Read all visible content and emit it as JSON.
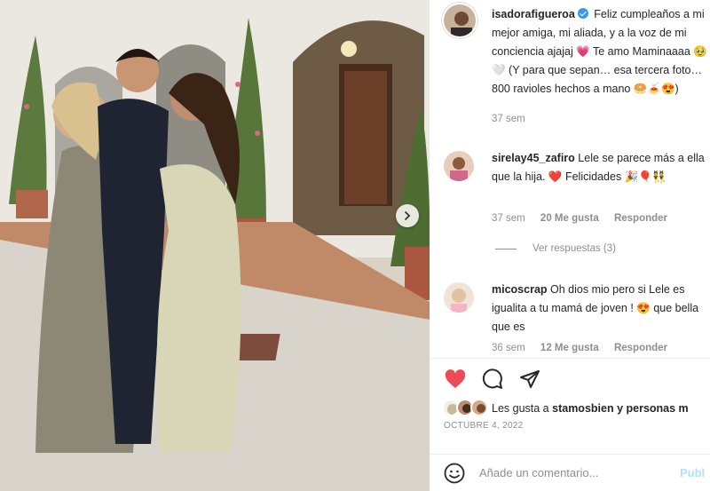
{
  "post": {
    "author": "isadorafigueroa",
    "caption": "Feliz cumpleaños a mi mejor amiga, mi aliada, y a la voz de mi conciencia ajajaj 💗 Te amo Maminaaaa 🥹🤍 (Y para que sepan… esa tercera foto…800 ravioles hechos a mano 🥯🍝😍)",
    "caption_time": "37 sem",
    "likes_prefix": "Les gusta a",
    "likes_user": "stamosbien",
    "likes_suffix": "y personas m",
    "date": "OCTUBRE 4, 2022"
  },
  "comments": [
    {
      "user": "sirelay45_zafiro",
      "text": "Lele se parece más a ella que la hija. ❤️ Felicidades 🎉🎈👯",
      "time": "37 sem",
      "likes": "20 Me gusta",
      "reply": "Responder",
      "view_replies": "Ver respuestas (3)"
    },
    {
      "user": "micoscrap",
      "text": "Oh dios mio pero si Lele es igualita a tu mamá de joven ! 😍 que bella que es",
      "time": "36 sem",
      "likes": "12 Me gusta",
      "reply": "Responder"
    }
  ],
  "composer": {
    "placeholder": "Añade un comentario...",
    "publish": "Publ"
  },
  "icons": {
    "like": "heart-filled-icon",
    "comment": "speech-bubble-icon",
    "share": "paper-plane-icon",
    "next": "chevron-right-icon",
    "emoji": "smiley-icon",
    "verified": "verified-badge-icon"
  },
  "colors": {
    "like_red": "#ed4956",
    "verified_blue": "#3897f0",
    "muted_text": "#8e8e8e",
    "publish_disabled": "#b2dffc"
  }
}
